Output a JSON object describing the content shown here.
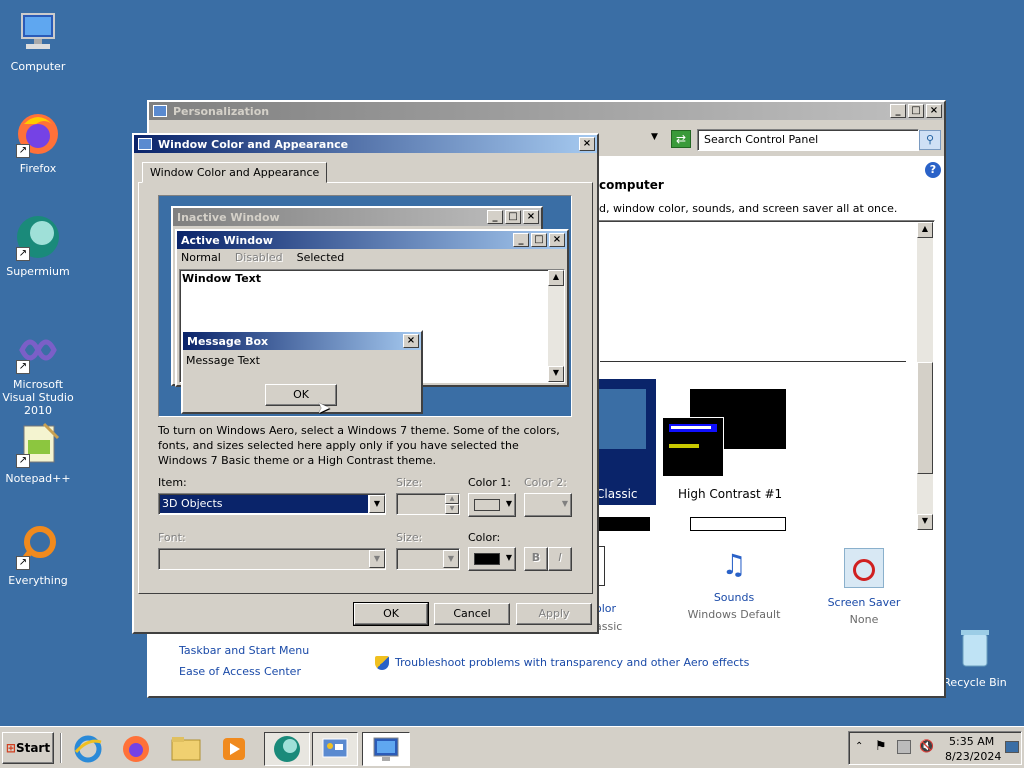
{
  "desktop": {
    "icons": [
      {
        "label": "Computer"
      },
      {
        "label": "Firefox"
      },
      {
        "label": "Supermium"
      },
      {
        "label": "Microsoft Visual Studio 2010"
      },
      {
        "label": "Notepad++"
      },
      {
        "label": "Everything"
      },
      {
        "label": "Recycle Bin"
      }
    ]
  },
  "personalization": {
    "title": "Personalization",
    "search_placeholder": "Search Control Panel",
    "heading_fragment": "computer",
    "desc_fragment": "d, window color, sounds, and screen saver all at once.",
    "themes": [
      {
        "label": "Classic"
      },
      {
        "label": "High Contrast #1"
      }
    ],
    "bottom_items": [
      {
        "label": "olor",
        "sub": "assic"
      },
      {
        "label": "Sounds",
        "sub": "Windows Default"
      },
      {
        "label": "Screen Saver",
        "sub": "None"
      }
    ],
    "see_also": [
      {
        "label": "Taskbar and Start Menu"
      },
      {
        "label": "Ease of Access Center"
      }
    ],
    "troubleshoot": "Troubleshoot problems with transparency and other Aero effects"
  },
  "dialog": {
    "title": "Window Color and Appearance",
    "tab": "Window Color and Appearance",
    "preview": {
      "inactive_title": "Inactive Window",
      "active_title": "Active Window",
      "menu": [
        "Normal",
        "Disabled",
        "Selected"
      ],
      "window_text": "Window Text",
      "msgbox_title": "Message Box",
      "msgbox_text": "Message Text",
      "msgbox_ok": "OK"
    },
    "info": "To turn on Windows Aero, select a Windows 7 theme.  Some of the colors, fonts, and sizes selected here apply only if you have selected the Windows 7 Basic theme or a High Contrast theme.",
    "item_label": "Item:",
    "item_value": "3D Objects",
    "size_label": "Size:",
    "color1_label": "Color 1:",
    "color2_label": "Color 2:",
    "font_label": "Font:",
    "size2_label": "Size:",
    "color_label": "Color:",
    "bold_label": "B",
    "italic_label": "I",
    "ok": "OK",
    "cancel": "Cancel",
    "apply": "Apply",
    "color1_value": "#d4d0c8",
    "color_value": "#000000"
  },
  "taskbar": {
    "start": "Start",
    "time": "5:35 AM",
    "date": "8/23/2024"
  }
}
